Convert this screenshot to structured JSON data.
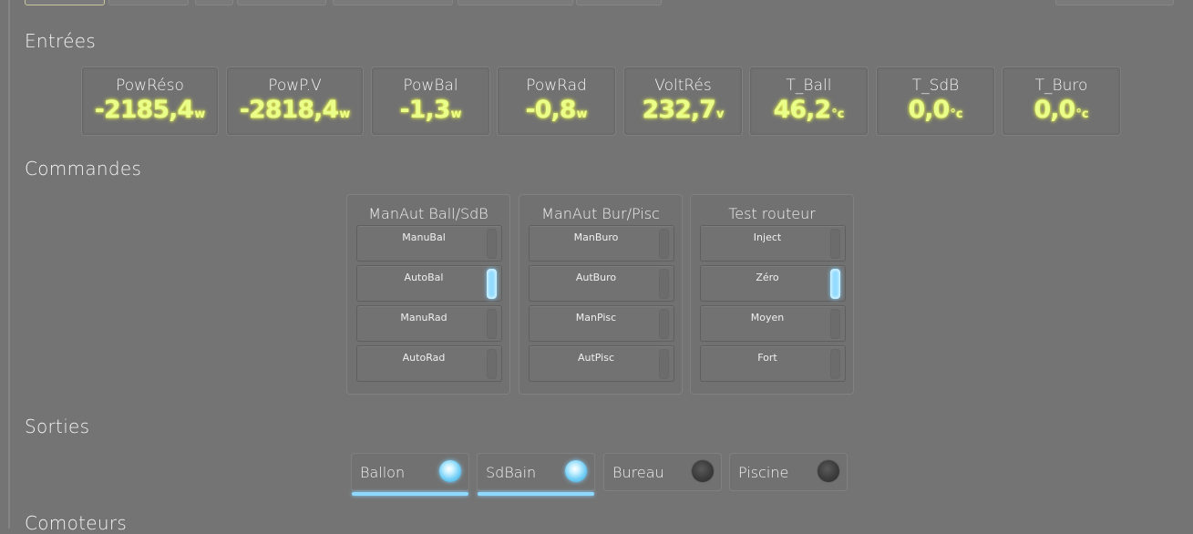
{
  "sections": {
    "inputs": "Entrées",
    "commands": "Commandes",
    "outputs": "Sorties",
    "meters": "Comoteurs"
  },
  "gauges": [
    {
      "label": "PowRéso",
      "value": "-2185,4",
      "unit": "w"
    },
    {
      "label": "PowP.V",
      "value": "-2818,4",
      "unit": "w"
    },
    {
      "label": "PowBal",
      "value": "-1,3",
      "unit": "w"
    },
    {
      "label": "PowRad",
      "value": "-0,8",
      "unit": "w"
    },
    {
      "label": "VoltRés",
      "value": "232,7",
      "unit": "v"
    },
    {
      "label": "T_Ball",
      "value": "46,2",
      "unit": "°c"
    },
    {
      "label": "T_SdB",
      "value": "0,0",
      "unit": "°c"
    },
    {
      "label": "T_Buro",
      "value": "0,0",
      "unit": "°c"
    }
  ],
  "commands": [
    {
      "title": "ManAut Ball/SdB",
      "buttons": [
        {
          "label": "ManuBal",
          "active": false
        },
        {
          "label": "AutoBal",
          "active": true
        },
        {
          "label": "ManuRad",
          "active": false
        },
        {
          "label": "AutoRad",
          "active": false
        }
      ]
    },
    {
      "title": "ManAut Bur/Pisc",
      "buttons": [
        {
          "label": "ManBuro",
          "active": false
        },
        {
          "label": "AutBuro",
          "active": false
        },
        {
          "label": "ManPisc",
          "active": false
        },
        {
          "label": "AutPisc",
          "active": false
        }
      ]
    },
    {
      "title": "Test routeur",
      "buttons": [
        {
          "label": "Inject",
          "active": false
        },
        {
          "label": "Zéro",
          "active": true
        },
        {
          "label": "Moyen",
          "active": false
        },
        {
          "label": "Fort",
          "active": false
        }
      ]
    }
  ],
  "outputs": [
    {
      "label": "Ballon",
      "on": true
    },
    {
      "label": "SdBain",
      "on": true
    },
    {
      "label": "Bureau",
      "on": false
    },
    {
      "label": "Piscine",
      "on": false
    }
  ],
  "colors": {
    "background": "#747474",
    "gauge_value": "#eaff8a",
    "indicator_on": "#93dcff"
  }
}
